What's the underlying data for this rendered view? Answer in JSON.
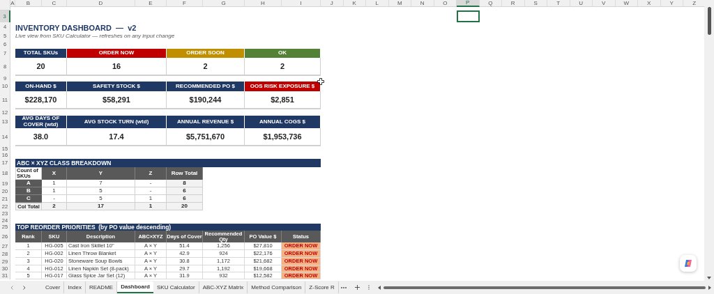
{
  "column_headers": [
    {
      "label": "A",
      "selected": false
    },
    {
      "label": "B",
      "selected": false
    },
    {
      "label": "C",
      "selected": false
    },
    {
      "label": "D",
      "selected": false
    },
    {
      "label": "E",
      "selected": false
    },
    {
      "label": "F",
      "selected": false
    },
    {
      "label": "G",
      "selected": false
    },
    {
      "label": "H",
      "selected": false
    },
    {
      "label": "I",
      "selected": false
    },
    {
      "label": "J",
      "selected": false
    },
    {
      "label": "K",
      "selected": false
    },
    {
      "label": "L",
      "selected": false
    },
    {
      "label": "M",
      "selected": false
    },
    {
      "label": "N",
      "selected": false
    },
    {
      "label": "O",
      "selected": false
    },
    {
      "label": "P",
      "selected": true
    },
    {
      "label": "Q",
      "selected": false
    },
    {
      "label": "R",
      "selected": false
    },
    {
      "label": "S",
      "selected": false
    },
    {
      "label": "T",
      "selected": false
    },
    {
      "label": "U",
      "selected": false
    },
    {
      "label": "V",
      "selected": false
    },
    {
      "label": "W",
      "selected": false
    },
    {
      "label": "X",
      "selected": false
    },
    {
      "label": "Y",
      "selected": false
    },
    {
      "label": "Z",
      "selected": false
    }
  ],
  "row_numbers": [
    {
      "label": "3",
      "selected": true
    },
    {
      "label": "4",
      "selected": false
    },
    {
      "label": "5",
      "selected": false
    },
    {
      "label": "6",
      "selected": false
    },
    {
      "label": "7",
      "selected": false
    },
    {
      "label": "8",
      "selected": false
    },
    {
      "label": "9",
      "selected": false
    },
    {
      "label": "10",
      "selected": false
    },
    {
      "label": "11",
      "selected": false
    },
    {
      "label": "12",
      "selected": false
    },
    {
      "label": "13",
      "selected": false
    },
    {
      "label": "14",
      "selected": false
    },
    {
      "label": "15",
      "selected": false
    },
    {
      "label": "16",
      "selected": false
    },
    {
      "label": "17",
      "selected": false
    },
    {
      "label": "18",
      "selected": false
    },
    {
      "label": "19",
      "selected": false
    },
    {
      "label": "20",
      "selected": false
    },
    {
      "label": "21",
      "selected": false
    },
    {
      "label": "22",
      "selected": false
    },
    {
      "label": "23",
      "selected": false
    },
    {
      "label": "24",
      "selected": false
    },
    {
      "label": "25",
      "selected": false
    },
    {
      "label": "26",
      "selected": false
    },
    {
      "label": "27",
      "selected": false
    },
    {
      "label": "28",
      "selected": false
    },
    {
      "label": "29",
      "selected": false
    },
    {
      "label": "30",
      "selected": false
    },
    {
      "label": "31",
      "selected": false
    }
  ],
  "title": "INVENTORY DASHBOARD  —  v2",
  "subtitle": "Live view from SKU Calculator — refreshes on any input change",
  "kpi_groups": [
    [
      {
        "label": "TOTAL SKUs",
        "value": "20",
        "color": "#1f3864"
      },
      {
        "label": "ORDER NOW",
        "value": "16",
        "color": "#c00000"
      },
      {
        "label": "ORDER SOON",
        "value": "2",
        "color": "#bf8f00"
      },
      {
        "label": "OK",
        "value": "2",
        "color": "#538135"
      }
    ],
    [
      {
        "label": "ON-HAND $",
        "value": "$228,170",
        "color": "#1f3864"
      },
      {
        "label": "SAFETY STOCK $",
        "value": "$58,291",
        "color": "#1f3864"
      },
      {
        "label": "RECOMMENDED PO $",
        "value": "$190,244",
        "color": "#1f3864"
      },
      {
        "label": "OOS RISK EXPOSURE $",
        "value": "$2,851",
        "color": "#c00000"
      }
    ],
    [
      {
        "label": "AVG DAYS OF COVER (wtd)",
        "value": "38.0",
        "color": "#1f3864"
      },
      {
        "label": "AVG STOCK TURN (wtd)",
        "value": "17.4",
        "color": "#1f3864"
      },
      {
        "label": "ANNUAL REVENUE $",
        "value": "$5,751,670",
        "color": "#1f3864"
      },
      {
        "label": "ANNUAL COGS $",
        "value": "$1,953,736",
        "color": "#1f3864"
      }
    ]
  ],
  "abc_xyz": {
    "title": "ABC × XYZ CLASS BREAKDOWN",
    "corner": "Count of SKUs",
    "columns": [
      "X",
      "Y",
      "Z",
      "Row Total"
    ],
    "rows": [
      {
        "label": "A",
        "cells": [
          "1",
          "7",
          "-",
          "8"
        ]
      },
      {
        "label": "B",
        "cells": [
          "1",
          "5",
          "-",
          "6"
        ]
      },
      {
        "label": "C",
        "cells": [
          "-",
          "5",
          "1",
          "6"
        ]
      }
    ],
    "total": {
      "label": "Col Total",
      "cells": [
        "2",
        "17",
        "1",
        "20"
      ]
    }
  },
  "priorities": {
    "title": "TOP REORDER PRIORITIES  (by PO value descending)",
    "columns": [
      "Rank",
      "SKU",
      "Description",
      "ABC×XYZ",
      "Days of Cover",
      "Recommended Qty",
      "PO Value $",
      "Status"
    ],
    "rows": [
      [
        "1",
        "HG-005",
        "Cast Iron Skillet 10\"",
        "A × Y",
        "51.4",
        "1,256",
        "$27,810",
        "ORDER NOW"
      ],
      [
        "2",
        "HG-002",
        "Linen Throw Blanket",
        "A × Y",
        "42.9",
        "924",
        "$22,176",
        "ORDER NOW"
      ],
      [
        "3",
        "HG-020",
        "Stoneware Soup Bowls",
        "A × Y",
        "30.8",
        "1,172",
        "$21,682",
        "ORDER NOW"
      ],
      [
        "4",
        "HG-012",
        "Linen Napkin Set (8-pack)",
        "A × Y",
        "29.7",
        "1,192",
        "$19,668",
        "ORDER NOW"
      ],
      [
        "5",
        "HG-017",
        "Glass Spice Jar Set (12)",
        "A × Y",
        "31.9",
        "932",
        "$12,582",
        "ORDER NOW"
      ]
    ]
  },
  "sheet_tabs": [
    {
      "label": "Cover",
      "selected": false
    },
    {
      "label": "Index",
      "selected": false
    },
    {
      "label": "README",
      "selected": false
    },
    {
      "label": "Dashboard",
      "selected": true
    },
    {
      "label": "SKU Calculator",
      "selected": false
    },
    {
      "label": "ABC-XYZ Matrix",
      "selected": false
    },
    {
      "label": "Method Comparison",
      "selected": false
    },
    {
      "label": "Z-Score R",
      "selected": false
    }
  ]
}
